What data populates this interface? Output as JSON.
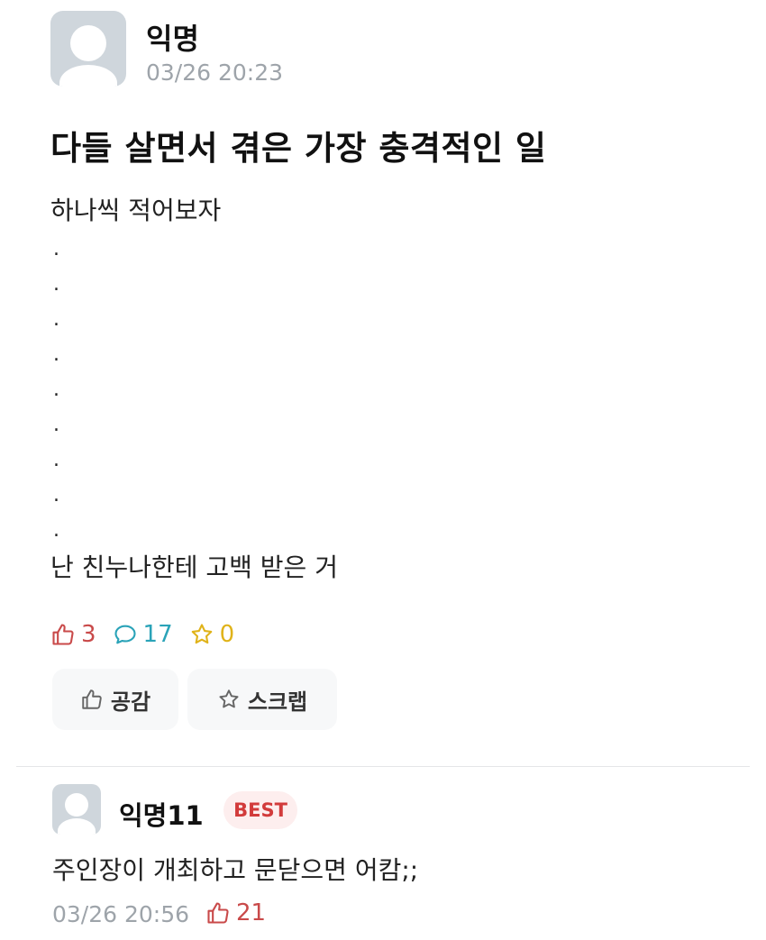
{
  "post": {
    "author": "익명",
    "time": "03/26 20:23",
    "title": "다들 살면서 겪은 가장 충격적인 일",
    "body_first": "하나씩 적어보자",
    "body_dots": [
      ".",
      ".",
      ".",
      ".",
      ".",
      ".",
      ".",
      ".",
      "."
    ],
    "body_last": "난 친누나한테 고백 받은 거",
    "stats": {
      "likes": "3",
      "comments": "17",
      "scraps": "0"
    },
    "actions": {
      "like_label": "공감",
      "scrap_label": "스크랩"
    }
  },
  "comment": {
    "author": "익명11",
    "badge": "BEST",
    "text": "주인장이 개최하고 문닫으면 어캄;;",
    "time": "03/26 20:56",
    "likes": "21"
  },
  "colors": {
    "like": "#c94a4a",
    "comment": "#2aa3b8",
    "scrap": "#e0b31a",
    "meta_gray": "#9ea4aa",
    "avatar_bg": "#cfd6dc"
  },
  "icons": {
    "like": "thumbs-up-icon",
    "comment": "speech-bubble-icon",
    "scrap": "star-icon"
  }
}
